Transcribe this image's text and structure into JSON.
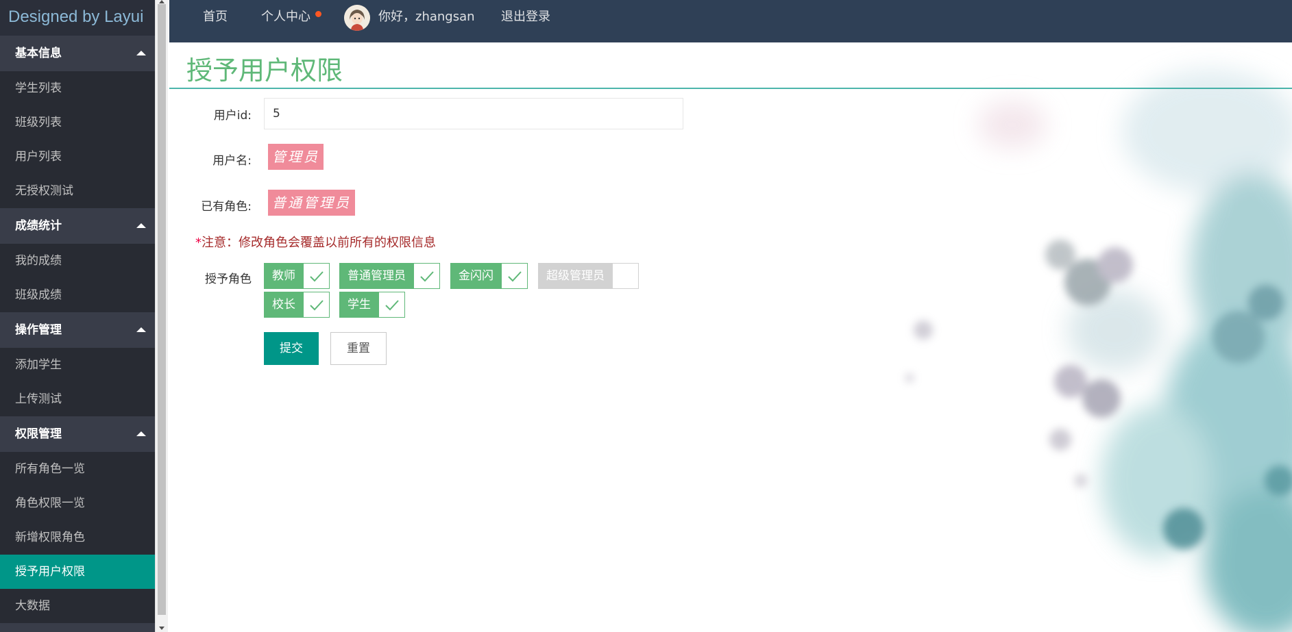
{
  "sidebar": {
    "logo": "Designed by Layui",
    "groups": [
      {
        "title": "基本信息",
        "items": [
          "学生列表",
          "班级列表",
          "用户列表",
          "无授权测试"
        ]
      },
      {
        "title": "成绩统计",
        "items": [
          "我的成绩",
          "班级成绩"
        ]
      },
      {
        "title": "操作管理",
        "items": [
          "添加学生",
          "上传测试"
        ]
      },
      {
        "title": "权限管理",
        "items": [
          "所有角色一览",
          "角色权限一览",
          "新增权限角色",
          "授予用户权限",
          "大数据"
        ]
      }
    ],
    "active_item": "授予用户权限"
  },
  "header": {
    "home": "首页",
    "personal_center": "个人中心",
    "greeting": "你好，zhangsan",
    "logout": "退出登录"
  },
  "main": {
    "title": "授予用户权限",
    "user_id_label": "用户id:",
    "user_id_value": "5",
    "username_label": "用户名:",
    "username_value": "管理员",
    "existing_roles_label": "已有角色:",
    "existing_roles_value": "普通管理员",
    "note_star": "*",
    "note_text": "注意：修改角色会覆盖以前所有的权限信息",
    "grant_roles_label": "授予角色",
    "roles": [
      {
        "name": "教师",
        "checked": true
      },
      {
        "name": "普通管理员",
        "checked": true
      },
      {
        "name": "金闪闪",
        "checked": true
      },
      {
        "name": "超级管理员",
        "checked": false
      },
      {
        "name": "校长",
        "checked": true
      },
      {
        "name": "学生",
        "checked": true
      }
    ],
    "submit_label": "提交",
    "reset_label": "重置"
  },
  "colors": {
    "sidebar_bg": "#393d49",
    "header_bg": "#2f4056",
    "accent": "#009688",
    "checked_green": "#5fb878",
    "tag_pink": "#f08b9a",
    "note_red": "#a52a2a"
  }
}
